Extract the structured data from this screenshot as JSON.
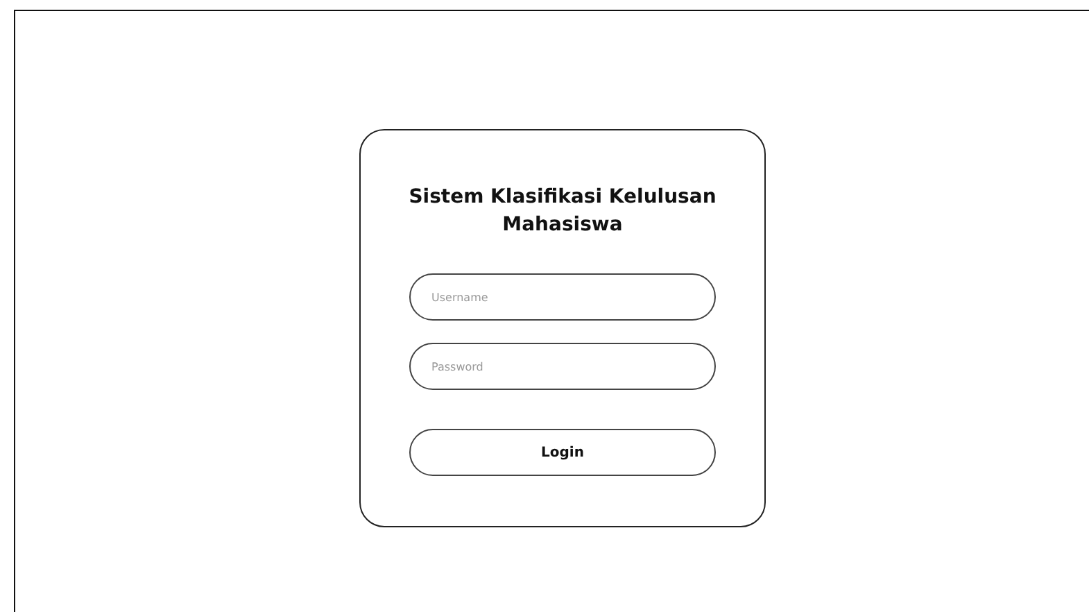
{
  "login_card": {
    "title": "Sistem Klasifikasi Kelulusan Mahasiswa",
    "fields": [
      {
        "placeholder": "Username"
      },
      {
        "placeholder": "Password"
      }
    ],
    "button": "Login"
  }
}
